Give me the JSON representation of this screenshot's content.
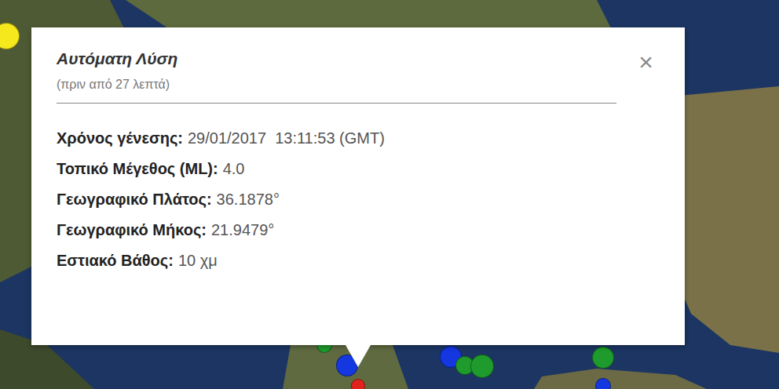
{
  "popup": {
    "title": "Αυτόματη Λύση",
    "subtitle": "(πριν από 27 λεπτά)",
    "close": "×",
    "fields": [
      {
        "label": "Χρόνος γένεσης:",
        "value": "29/01/2017  13:11:53 (GMT)"
      },
      {
        "label": "Τοπικό Μέγεθος (ML):",
        "value": "4.0"
      },
      {
        "label": "Γεωγραφικό Πλάτος:",
        "value": "36.1878°"
      },
      {
        "label": "Γεωγραφικό Μήκος:",
        "value": "21.9479°"
      },
      {
        "label": "Εστιακό Βάθος:",
        "value": "10 χμ"
      }
    ]
  },
  "markers": [
    {
      "color": "#f5e81c"
    },
    {
      "color": "#1e9b2c"
    },
    {
      "color": "#1437e0"
    },
    {
      "color": "#e0231c"
    },
    {
      "color": "#1437e0"
    },
    {
      "color": "#1e9b2c"
    },
    {
      "color": "#1e9b2c"
    },
    {
      "color": "#1e9b2c"
    },
    {
      "color": "#1437e0"
    }
  ]
}
